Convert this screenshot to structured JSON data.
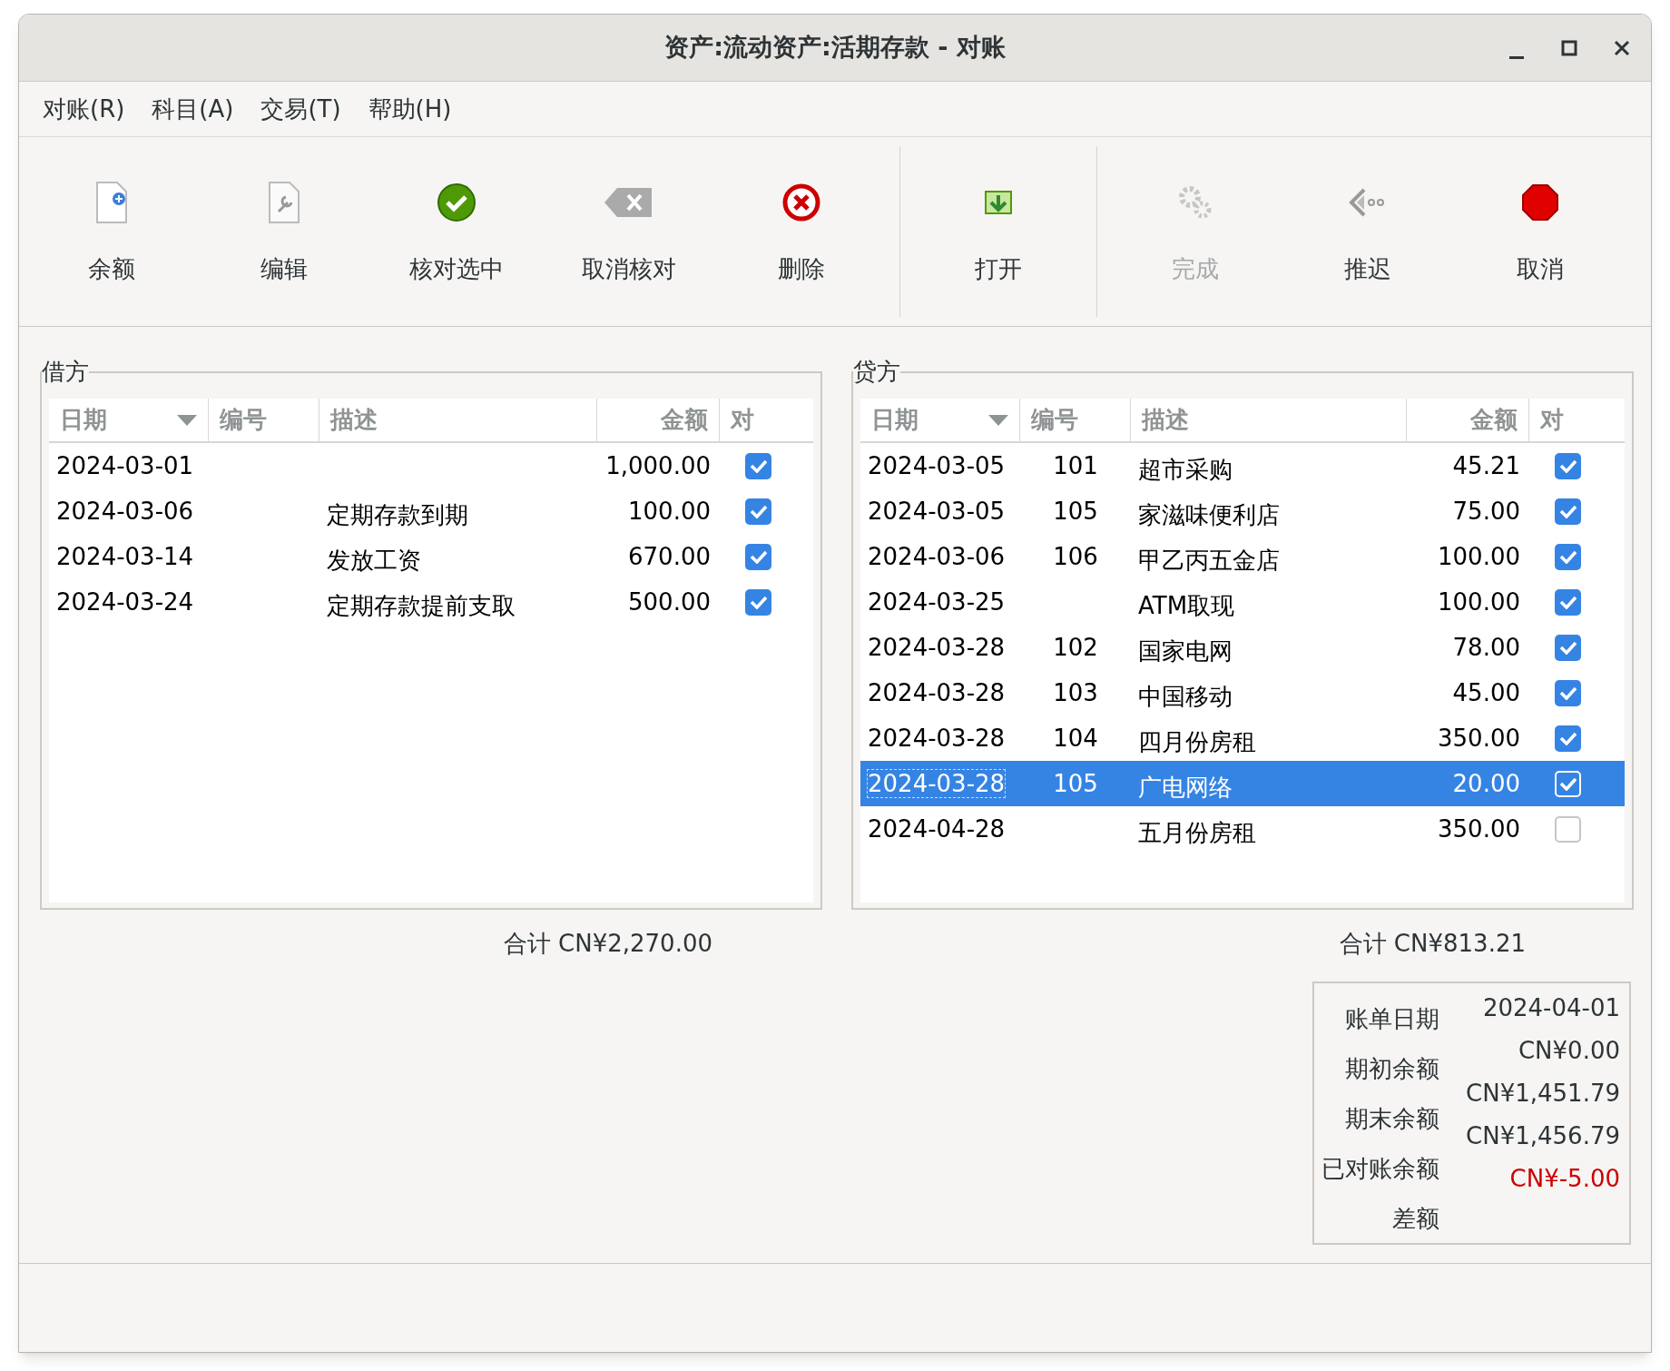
{
  "window": {
    "title": "资产:流动资产:活期存款 - 对账"
  },
  "menu": [
    "对账(R)",
    "科目(A)",
    "交易(T)",
    "帮助(H)"
  ],
  "toolbar": [
    {
      "label": "余额",
      "disabled": false,
      "group_end": false
    },
    {
      "label": "编辑",
      "disabled": false,
      "group_end": false
    },
    {
      "label": "核对选中",
      "disabled": false,
      "group_end": false
    },
    {
      "label": "取消核对",
      "disabled": false,
      "group_end": false
    },
    {
      "label": "删除",
      "disabled": false,
      "group_end": true
    },
    {
      "label": "打开",
      "disabled": false,
      "group_end": true
    },
    {
      "label": "完成",
      "disabled": true,
      "group_end": false
    },
    {
      "label": "推迟",
      "disabled": false,
      "group_end": false
    },
    {
      "label": "取消",
      "disabled": false,
      "group_end": false
    }
  ],
  "panels": [
    {
      "title": "借方",
      "columns": [
        "日期",
        "编号",
        "描述",
        "金额",
        "对"
      ],
      "rows": [
        {
          "date": "2024-03-01",
          "amount": "1,000.00",
          "checked": true,
          "selected": false
        },
        {
          "date": "2024-03-06",
          "description": "定期存款到期",
          "amount": "100.00",
          "checked": true,
          "selected": false
        },
        {
          "date": "2024-03-14",
          "description": "发放工资",
          "amount": "670.00",
          "checked": true,
          "selected": false
        },
        {
          "date": "2024-03-24",
          "description": "定期存款提前支取",
          "amount": "500.00",
          "checked": true,
          "selected": false
        }
      ],
      "total": "合计 CN¥2,270.00"
    },
    {
      "title": "贷方",
      "columns": [
        "日期",
        "编号",
        "描述",
        "金额",
        "对"
      ],
      "rows": [
        {
          "date": "2024-03-05",
          "number": "101",
          "description": "超市采购",
          "amount": "45.21",
          "checked": true,
          "selected": false
        },
        {
          "date": "2024-03-05",
          "number": "105",
          "description": "家滋味便利店",
          "amount": "75.00",
          "checked": true,
          "selected": false
        },
        {
          "date": "2024-03-06",
          "number": "106",
          "description": "甲乙丙五金店",
          "amount": "100.00",
          "checked": true,
          "selected": false
        },
        {
          "date": "2024-03-25",
          "description": "ATM取现",
          "amount": "100.00",
          "checked": true,
          "selected": false
        },
        {
          "date": "2024-03-28",
          "number": "102",
          "description": "国家电网",
          "amount": "78.00",
          "checked": true,
          "selected": false
        },
        {
          "date": "2024-03-28",
          "number": "103",
          "description": "中国移动",
          "amount": "45.00",
          "checked": true,
          "selected": false
        },
        {
          "date": "2024-03-28",
          "number": "104",
          "description": "四月份房租",
          "amount": "350.00",
          "checked": true,
          "selected": false
        },
        {
          "date": "2024-03-28",
          "number": "105",
          "description": "广电网络",
          "amount": "20.00",
          "checked": true,
          "selected": true
        },
        {
          "date": "2024-04-28",
          "description": "五月份房租",
          "amount": "350.00",
          "checked": false,
          "selected": false
        }
      ],
      "total": "合计 CN¥813.21"
    }
  ],
  "summary": {
    "labels": [
      "账单日期",
      "期初余额",
      "期末余额",
      "已对账余额",
      "差额"
    ],
    "values": [
      {
        "text": "2024-04-01",
        "negative": false
      },
      {
        "text": "CN¥0.00",
        "negative": false
      },
      {
        "text": "CN¥1,451.79",
        "negative": false
      },
      {
        "text": "CN¥1,456.79",
        "negative": false
      },
      {
        "text": "CN¥-5.00",
        "negative": true
      }
    ]
  }
}
